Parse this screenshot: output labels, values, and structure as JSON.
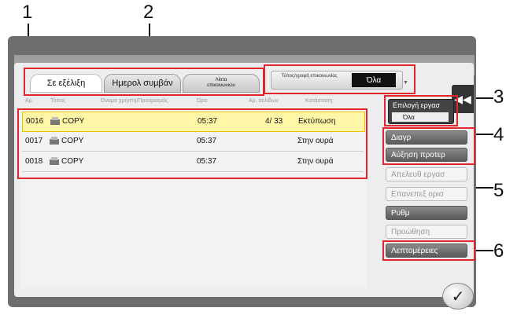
{
  "callouts": [
    "1",
    "2",
    "3",
    "4",
    "5",
    "6"
  ],
  "tabs": {
    "in_progress": "Σε εξέλιξη",
    "log": "Ημερολ συμβάν",
    "comm_list": "Λίστα επικοινωνιών"
  },
  "job_type": {
    "label": "Τύπος/γραφή επικοινωνίας",
    "value": "Όλα"
  },
  "table": {
    "headers": [
      "Αρ.",
      "Τύπος",
      "Όνομα χρήστη/Προορισμός",
      "Ώρα",
      "Αρ. σελίδων",
      "Κατάσταση"
    ],
    "rows": [
      {
        "no": "0016",
        "type": "COPY",
        "time": "05:37",
        "pages": "4/  33",
        "status": "Εκτύπωση",
        "selected": true
      },
      {
        "no": "0017",
        "type": "COPY",
        "time": "05:37",
        "pages": "",
        "status": "Στην ουρά",
        "selected": false
      },
      {
        "no": "0018",
        "type": "COPY",
        "time": "05:37",
        "pages": "",
        "status": "Στην ουρά",
        "selected": false
      }
    ]
  },
  "right_panel": {
    "job_select_title": "Επιλογή εργασ",
    "job_select_value": "Όλα",
    "delete": "Διαγρ",
    "raise_priority": "Αύξηση προτερ",
    "release_job": "Απελευθ εργασ",
    "check_job": "Επανεπεξ ορισ",
    "settings": "Ρυθμ",
    "advance": "Προώθηση",
    "details": "Λεπτομέρειες"
  },
  "icons": {
    "back": "◀◀",
    "ok": "✓"
  },
  "colors": {
    "highlight": "#e0262c",
    "selected_row": "#fff6a8"
  }
}
